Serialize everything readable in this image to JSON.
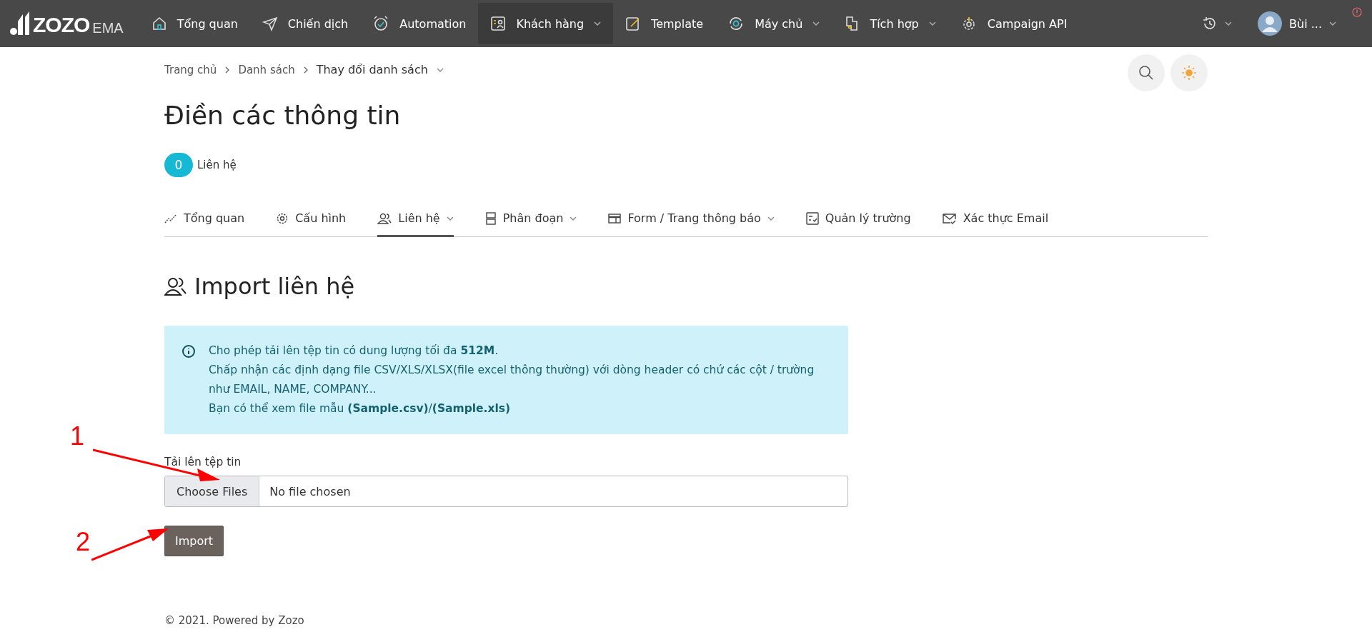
{
  "brand": {
    "logo": "ZOZO",
    "suffix": "EMA"
  },
  "nav": [
    {
      "label": "Tổng quan",
      "selected": false,
      "dropdown": false
    },
    {
      "label": "Chiến dịch",
      "selected": false,
      "dropdown": false
    },
    {
      "label": "Automation",
      "selected": false,
      "dropdown": false
    },
    {
      "label": "Khách hàng",
      "selected": true,
      "dropdown": true
    },
    {
      "label": "Template",
      "selected": false,
      "dropdown": false
    },
    {
      "label": "Máy chủ",
      "selected": false,
      "dropdown": true
    },
    {
      "label": "Tích hợp",
      "selected": false,
      "dropdown": true
    },
    {
      "label": "Campaign API",
      "selected": false,
      "dropdown": false
    }
  ],
  "user": {
    "name": "Bùi ..."
  },
  "breadcrumb": [
    "Trang chủ",
    "Danh sách",
    "Thay đổi danh sách"
  ],
  "title": "Điền các thông tin",
  "contacts": {
    "count": "0",
    "label": "Liên hệ"
  },
  "tabs": [
    {
      "label": "Tổng quan",
      "selected": false,
      "dropdown": false
    },
    {
      "label": "Cấu hình",
      "selected": false,
      "dropdown": false
    },
    {
      "label": "Liên hệ",
      "selected": true,
      "dropdown": true
    },
    {
      "label": "Phân đoạn",
      "selected": false,
      "dropdown": true
    },
    {
      "label": "Form / Trang thông báo",
      "selected": false,
      "dropdown": true
    },
    {
      "label": "Quản lý trường",
      "selected": false,
      "dropdown": false
    },
    {
      "label": "Xác thực Email",
      "selected": false,
      "dropdown": false
    }
  ],
  "section_title": "Import liên hệ",
  "info": [
    "Cho phép tải lên tệp tin có dung lượng tối đa **512M**.",
    "Chấp nhận các định dạng file CSV/XLS/XLSX(file excel thông thường) với dòng header có chứ các cột / trường như EMAIL, NAME, COMPANY...",
    "Bạn có thể xem file mẫu **(Sample.csv)**/**(Sample.xls)**"
  ],
  "upload": {
    "label": "Tải lên tệp tin",
    "button": "Choose Files",
    "value": "No file chosen"
  },
  "submit": "Import",
  "annotations": [
    "1",
    "2"
  ],
  "footer": "© 2021. Powered by Zozo"
}
